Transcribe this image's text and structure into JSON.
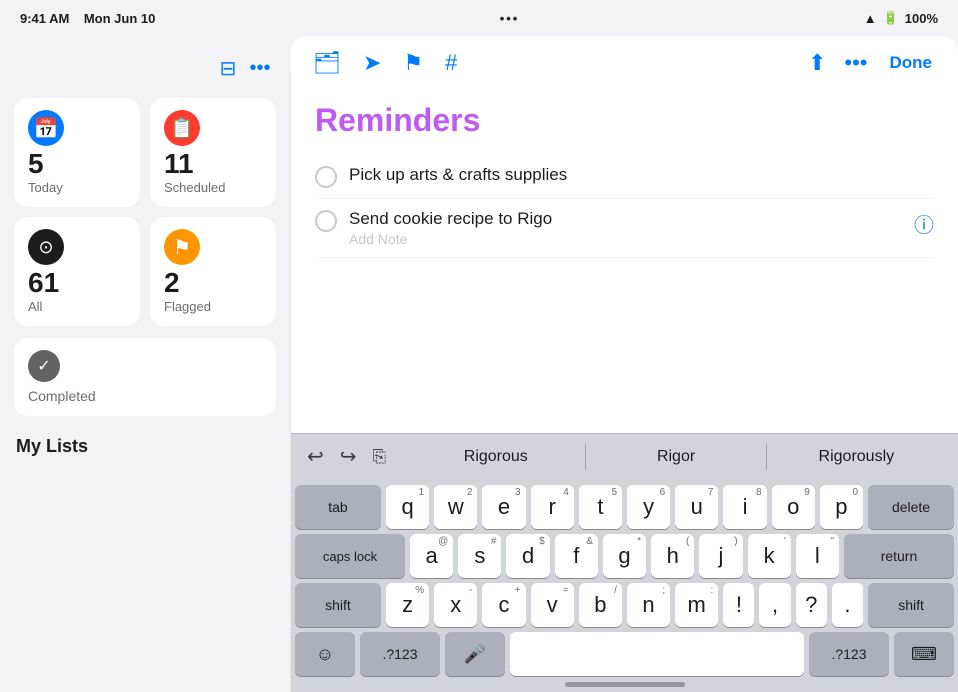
{
  "statusBar": {
    "time": "9:41 AM",
    "date": "Mon Jun 10",
    "dots": "•••",
    "wifi": "WiFi",
    "battery": "100%"
  },
  "sidebar": {
    "smartLists": [
      {
        "id": "today",
        "label": "Today",
        "count": "5",
        "iconClass": "icon-today",
        "icon": "📅"
      },
      {
        "id": "scheduled",
        "label": "Scheduled",
        "count": "11",
        "iconClass": "icon-scheduled",
        "icon": "📋"
      },
      {
        "id": "all",
        "label": "All",
        "count": "61",
        "iconClass": "icon-all",
        "icon": "⊙"
      },
      {
        "id": "flagged",
        "label": "Flagged",
        "count": "2",
        "iconClass": "icon-flagged",
        "icon": "⚑"
      }
    ],
    "completed": {
      "label": "Completed",
      "icon": "✓"
    },
    "myListsHeader": "My Lists"
  },
  "toolbar": {
    "icons": [
      "🗂",
      "➤",
      "⚑",
      "#"
    ],
    "shareLabel": "Share",
    "moreLabel": "More",
    "doneLabel": "Done"
  },
  "reminders": {
    "title": "Reminders",
    "items": [
      {
        "id": 1,
        "text": "Pick up arts & crafts supplies",
        "hasInfo": false
      },
      {
        "id": 2,
        "text": "Send cookie recipe to Rigo",
        "hasInfo": true,
        "addNote": "Add Note"
      }
    ]
  },
  "autocomplete": {
    "undoLabel": "↩",
    "redoLabel": "↪",
    "pasteLabel": "⎘",
    "suggestions": [
      "Rigorous",
      "Rigor",
      "Rigorously"
    ]
  },
  "keyboard": {
    "row1": [
      {
        "char": "q",
        "num": "1"
      },
      {
        "char": "w",
        "num": "2"
      },
      {
        "char": "e",
        "num": "3"
      },
      {
        "char": "r",
        "num": "4"
      },
      {
        "char": "t",
        "num": "5"
      },
      {
        "char": "y",
        "num": "6"
      },
      {
        "char": "u",
        "num": "7"
      },
      {
        "char": "i",
        "num": "8"
      },
      {
        "char": "o",
        "num": "9"
      },
      {
        "char": "p",
        "num": "0"
      }
    ],
    "row2": [
      {
        "char": "a",
        "num": "@"
      },
      {
        "char": "s",
        "num": "#"
      },
      {
        "char": "d",
        "num": "$"
      },
      {
        "char": "f",
        "num": "&"
      },
      {
        "char": "g",
        "num": "*"
      },
      {
        "char": "h",
        "num": "("
      },
      {
        "char": "j",
        "num": ")"
      },
      {
        "char": "k",
        "num": "'"
      },
      {
        "char": "l",
        "num": "\""
      }
    ],
    "row3": [
      {
        "char": "z",
        "num": "%"
      },
      {
        "char": "x",
        "num": "-"
      },
      {
        "char": "c",
        "num": "+"
      },
      {
        "char": "v",
        "num": "="
      },
      {
        "char": "b",
        "num": "/"
      },
      {
        "char": "n",
        "num": ";"
      },
      {
        "char": "m",
        "num": ":"
      },
      {
        "char": "!",
        "num": ""
      },
      {
        "char": ",",
        "num": ""
      },
      {
        "char": "?",
        "num": ""
      },
      {
        "char": ".",
        "num": ""
      }
    ],
    "modifiers": {
      "tab": "tab",
      "capsLock": "caps lock",
      "shift": "shift",
      "shiftR": "shift",
      "delete": "delete",
      "return": "return",
      "emoji": "☺",
      "num1": ".?123",
      "num2": ".?123",
      "mic": "🎤",
      "hide": "⌨"
    }
  }
}
